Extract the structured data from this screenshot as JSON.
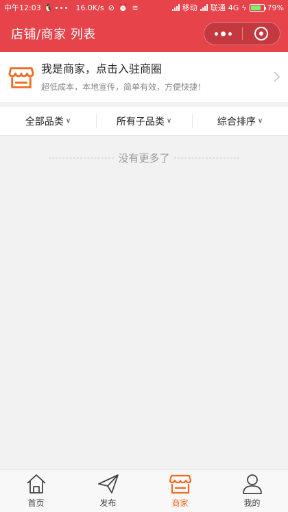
{
  "status_bar": {
    "time": "中午12:03",
    "speed": "16.0K/s",
    "carrier1": "移动",
    "carrier2": "联通",
    "network": "4G",
    "battery": "79%",
    "battery_level": 0.79
  },
  "navbar": {
    "title": "店铺/商家 列表"
  },
  "join_banner": {
    "title": "我是商家，点击入驻商圈",
    "subtitle": "超低成本，本地宣传，简单有效，方便快捷！"
  },
  "filters": [
    {
      "label": "全部品类"
    },
    {
      "label": "所有子品类"
    },
    {
      "label": "综合排序"
    }
  ],
  "empty_message": "没有更多了",
  "tabbar": [
    {
      "label": "首页",
      "icon": "home-icon",
      "active": false
    },
    {
      "label": "发布",
      "icon": "send-icon",
      "active": false
    },
    {
      "label": "商家",
      "icon": "shop-icon",
      "active": true
    },
    {
      "label": "我的",
      "icon": "profile-icon",
      "active": false
    }
  ],
  "colors": {
    "primary": "#e6434b",
    "accent": "#f06a1f"
  }
}
